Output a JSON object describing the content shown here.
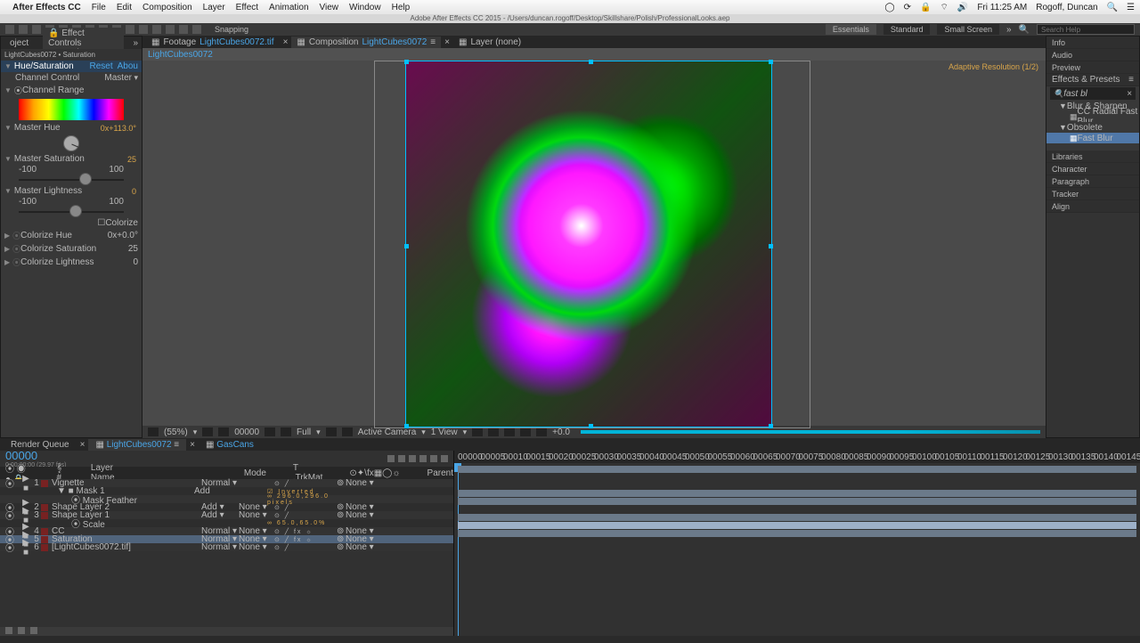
{
  "mac": {
    "app": "After Effects CC",
    "menus": [
      "File",
      "Edit",
      "Composition",
      "Layer",
      "Effect",
      "Animation",
      "View",
      "Window",
      "Help"
    ],
    "time": "Fri 11:25 AM",
    "user": "Rogoff, Duncan"
  },
  "titlebar": "Adobe After Effects CC 2015 - /Users/duncan.rogoff/Desktop/Skillshare/Polish/ProfessionalLooks.aep",
  "toolbar": {
    "snapping_label": "Snapping"
  },
  "workspaces": {
    "active": "Essentials",
    "items": [
      "Essentials",
      "Standard",
      "Small Screen"
    ],
    "search_placeholder": "Search Help"
  },
  "leftPanel": {
    "tab_project": "oject",
    "tab_effect": "Effect Controls Saturation",
    "header": "LightCubes0072 • Saturation",
    "effect_name": "Hue/Saturation",
    "reset": "Reset",
    "about": "Abou",
    "channel_control_label": "Channel Control",
    "channel_control_val": "Master",
    "channel_range": "Channel Range",
    "master_hue_label": "Master Hue",
    "master_hue_val": "0x+113.0°",
    "master_sat_label": "Master Saturation",
    "master_sat_val": "25",
    "range_lo": "-100",
    "range_hi": "100",
    "master_light_label": "Master Lightness",
    "master_light_val": "0",
    "colorize_label": "Colorize",
    "colorize_hue": "Colorize Hue",
    "colorize_hue_val": "0x+0.0°",
    "colorize_sat": "Colorize Saturation",
    "colorize_sat_val": "25",
    "colorize_light": "Colorize Lightness",
    "colorize_light_val": "0"
  },
  "center": {
    "footage_tab_prefix": "Footage",
    "footage_tab_name": "LightCubes0072.tif",
    "comp_tab_prefix": "Composition",
    "comp_tab_name": "LightCubes0072",
    "layer_tab": "Layer (none)",
    "subtab": "LightCubes0072",
    "adaptive": "Adaptive Resolution (1/2)",
    "footer": {
      "zoom": "(55%)",
      "tc": "00000",
      "res": "Full",
      "camera": "Active Camera",
      "views": "1 View",
      "exposure": "+0.0"
    }
  },
  "rightPanel": {
    "items_top": [
      "Info",
      "Audio",
      "Preview"
    ],
    "effects_presets": "Effects & Presets",
    "search_val": "fast bl",
    "group1": "Blur & Sharpen",
    "preset1": "CC Radial Fast Blur",
    "group2": "Obsolete",
    "preset_sel": "Fast Blur",
    "items_bottom": [
      "Libraries",
      "Character",
      "Paragraph",
      "Tracker",
      "Align"
    ]
  },
  "timeline": {
    "tab_rq": "Render Queue",
    "tab_active": "LightCubes0072",
    "tab3": "GasCans",
    "timecode": "00000",
    "fps": "0:00:00:00 (29.97 fps)",
    "cols": {
      "layer_name": "Layer Name",
      "mode": "Mode",
      "trkmat": "T .TrkMat",
      "parent": "Parent"
    },
    "layers": [
      {
        "num": "1",
        "name": "Vignette",
        "mode": "Normal",
        "trk": "",
        "parent": "None",
        "sw": "⊙ ╱ ",
        "sel": false
      },
      {
        "sub": true,
        "indent": 1,
        "name": "Mask 1",
        "mode": "Add",
        "trk": "",
        "parent": "",
        "sw": "",
        "extra": "Inverted"
      },
      {
        "sub": true,
        "indent": 2,
        "name": "Mask Feather",
        "mode": "",
        "trk": "",
        "parent": "",
        "sw": "",
        "val": "∞ 296.0,296.0 pixels"
      },
      {
        "num": "2",
        "name": "Shape Layer 2",
        "mode": "Add",
        "trk": "None",
        "parent": "None",
        "sw": "⊙ ╱ ",
        "sel": false
      },
      {
        "num": "3",
        "name": "Shape Layer 1",
        "mode": "Add",
        "trk": "None",
        "parent": "None",
        "sw": "⊙ ╱ ",
        "sel": false
      },
      {
        "sub": true,
        "indent": 2,
        "name": "Scale",
        "mode": "",
        "trk": "",
        "parent": "",
        "sw": "",
        "val": "∞ 65.0,65.0%"
      },
      {
        "num": "4",
        "name": "CC",
        "mode": "Normal",
        "trk": "None",
        "parent": "None",
        "sw": "⊙ ╱ fx  ☼",
        "sel": false
      },
      {
        "num": "5",
        "name": "Saturation",
        "mode": "Normal",
        "trk": "None",
        "parent": "None",
        "sw": "⊙ ╱ fx  ☼",
        "sel": true
      },
      {
        "num": "6",
        "name": "[LightCubes0072.tif]",
        "mode": "Normal",
        "trk": "None",
        "parent": "None",
        "sw": "⊙ ╱ ",
        "sel": false
      }
    ],
    "ruler": [
      "00000",
      "00005",
      "00010",
      "00015",
      "00020",
      "00025",
      "00030",
      "00035",
      "00040",
      "00045",
      "00050",
      "00055",
      "00060",
      "00065",
      "00070",
      "00075",
      "00080",
      "00085",
      "00090",
      "00095",
      "00100",
      "00105",
      "00110",
      "00115",
      "00120",
      "00125",
      "00130",
      "00135",
      "00140",
      "00145"
    ]
  }
}
